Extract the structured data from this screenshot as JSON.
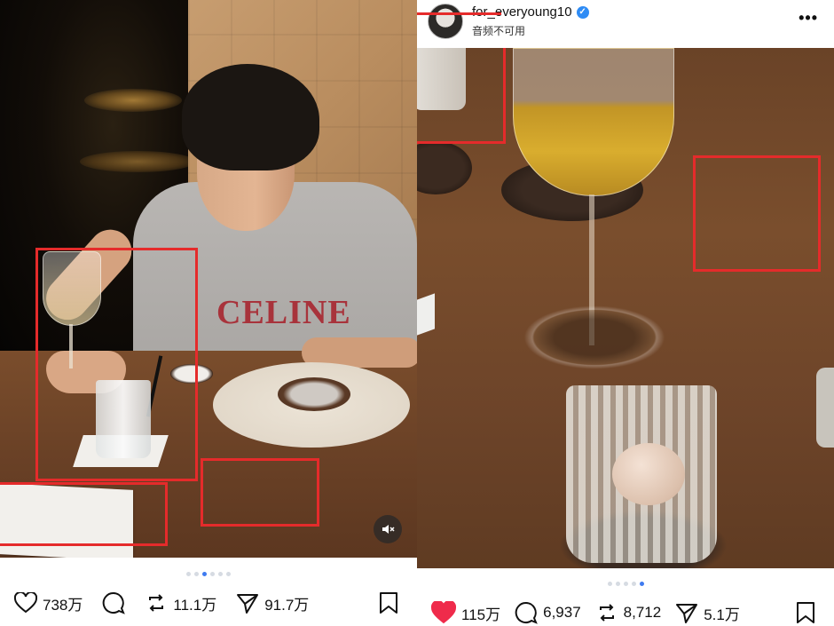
{
  "left_post": {
    "carousel_dots": [
      false,
      false,
      true,
      false,
      false,
      false
    ],
    "actions": {
      "likes": "738万",
      "repost": "11.1万",
      "shares": "91.7万"
    },
    "shirt_text": "CELINE"
  },
  "right_post": {
    "username": "for_everyoung10",
    "subtitle": "音频不可用",
    "more_label": "•••",
    "carousel_dots": [
      false,
      false,
      false,
      false,
      true
    ],
    "actions": {
      "likes": "115万",
      "comments": "6,937",
      "repost": "8,712",
      "shares": "5.1万"
    },
    "liked": true
  },
  "colors": {
    "annotation_red": "#e52b2b",
    "like_red": "#ef2b4b",
    "active_dot": "#3f7bf0"
  },
  "icons": [
    "heart-icon",
    "comment-icon",
    "repost-icon",
    "send-icon",
    "bookmark-icon",
    "mute-icon",
    "verified-icon",
    "more-icon"
  ]
}
